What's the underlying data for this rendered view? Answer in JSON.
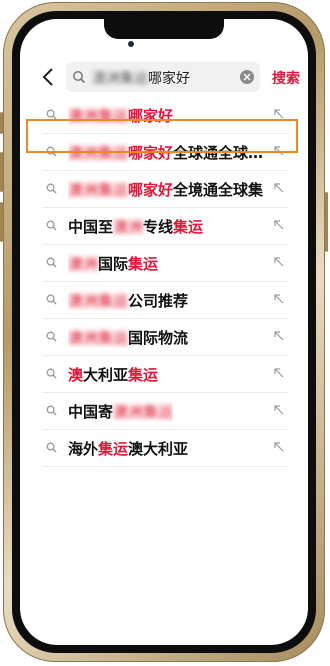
{
  "header": {
    "query_blurred": "澳洲集运",
    "query_tail": "哪家好",
    "search_label": "搜索"
  },
  "suggestions": [
    {
      "segments": [
        {
          "t": "澳洲集运",
          "s": "blur"
        },
        {
          "t": "哪家好",
          "s": "hl"
        }
      ]
    },
    {
      "segments": [
        {
          "t": "澳洲集运",
          "s": "blur"
        },
        {
          "t": "哪家好",
          "s": "hl"
        },
        {
          "t": "全球通全球…",
          "s": "pl"
        }
      ]
    },
    {
      "segments": [
        {
          "t": "澳洲集运",
          "s": "blur"
        },
        {
          "t": "哪家好",
          "s": "hl"
        },
        {
          "t": "全境通全球集",
          "s": "pl"
        }
      ]
    },
    {
      "segments": [
        {
          "t": "中国至",
          "s": "pl"
        },
        {
          "t": "澳洲",
          "s": "blur"
        },
        {
          "t": "专线",
          "s": "pl"
        },
        {
          "t": "集运",
          "s": "hl"
        }
      ]
    },
    {
      "segments": [
        {
          "t": "澳洲",
          "s": "blur"
        },
        {
          "t": "国际",
          "s": "pl"
        },
        {
          "t": "集运",
          "s": "hl"
        }
      ]
    },
    {
      "segments": [
        {
          "t": "澳洲集运",
          "s": "blur"
        },
        {
          "t": "公司推荐",
          "s": "pl"
        }
      ]
    },
    {
      "segments": [
        {
          "t": "澳洲集运",
          "s": "blur"
        },
        {
          "t": "国际物流",
          "s": "pl"
        }
      ]
    },
    {
      "segments": [
        {
          "t": "澳",
          "s": "hl"
        },
        {
          "t": "大利亚",
          "s": "pl"
        },
        {
          "t": "集运",
          "s": "hl"
        }
      ]
    },
    {
      "segments": [
        {
          "t": "中国寄",
          "s": "pl"
        },
        {
          "t": "澳洲集运",
          "s": "blur"
        }
      ]
    },
    {
      "segments": [
        {
          "t": "海外",
          "s": "pl"
        },
        {
          "t": "集运",
          "s": "hl"
        },
        {
          "t": "澳大利亚",
          "s": "pl"
        }
      ]
    }
  ],
  "colors": {
    "accent": "#e4163a",
    "highlight_box": "#e8892a",
    "frame": "#b69a68"
  },
  "icons": {
    "back": "chevron-left-icon",
    "search": "magnifier-icon",
    "clear": "clear-icon",
    "fill": "arrow-up-left-icon"
  }
}
